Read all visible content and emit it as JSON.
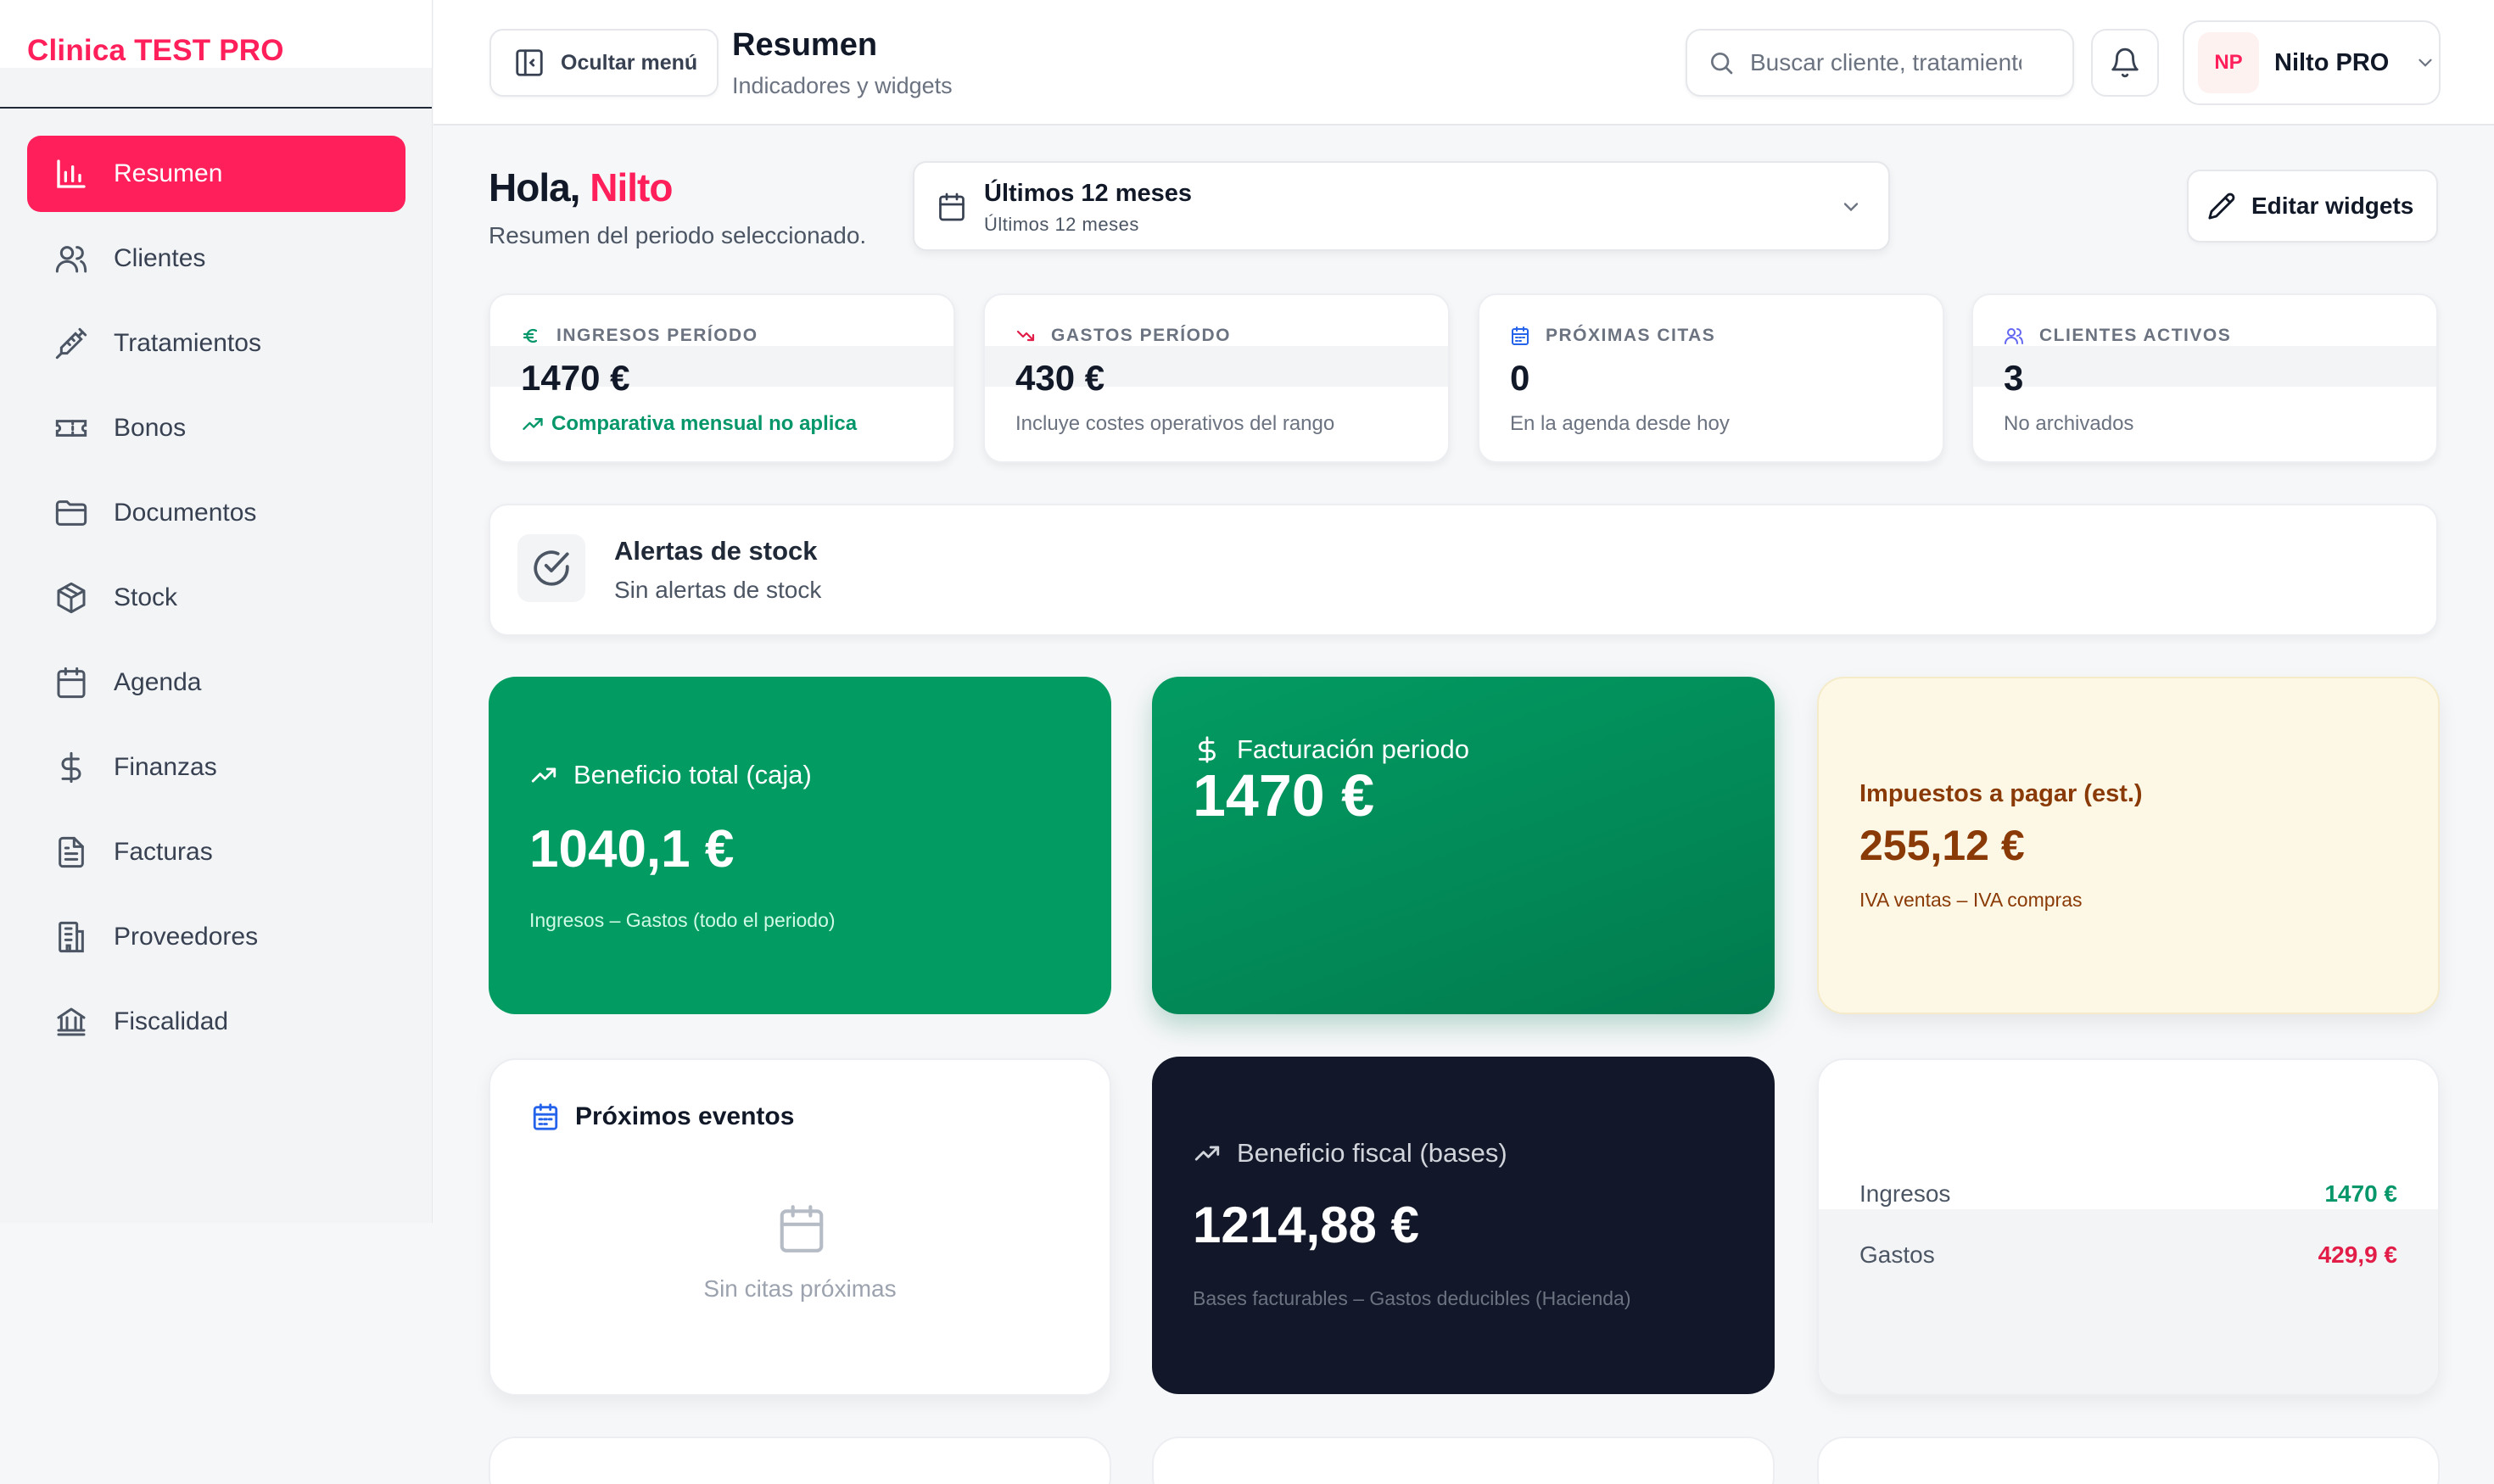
{
  "app": {
    "brand": "Clinica TEST PRO"
  },
  "sidebar": {
    "items": [
      {
        "label": "Resumen",
        "icon": "bar-chart-icon",
        "active": true
      },
      {
        "label": "Clientes",
        "icon": "users-icon"
      },
      {
        "label": "Tratamientos",
        "icon": "syringe-icon"
      },
      {
        "label": "Bonos",
        "icon": "ticket-icon"
      },
      {
        "label": "Documentos",
        "icon": "folder-icon"
      },
      {
        "label": "Stock",
        "icon": "box-icon"
      },
      {
        "label": "Agenda",
        "icon": "calendar-icon"
      },
      {
        "label": "Finanzas",
        "icon": "dollar-icon"
      },
      {
        "label": "Facturas",
        "icon": "file-icon"
      },
      {
        "label": "Proveedores",
        "icon": "building-icon"
      },
      {
        "label": "Fiscalidad",
        "icon": "bank-icon"
      }
    ]
  },
  "header": {
    "hide_menu": "Ocultar menú",
    "title": "Resumen",
    "subtitle": "Indicadores y widgets",
    "search_placeholder": "Buscar cliente, tratamiento",
    "user_initials": "NP",
    "user_name": "Nilto PRO"
  },
  "greeting": {
    "hello": "Hola,",
    "name": "Nilto",
    "subtitle": "Resumen del periodo seleccionado."
  },
  "period": {
    "selected": "Últimos 12 meses",
    "detail": "Últimos 12 meses"
  },
  "edit_widgets": "Editar widgets",
  "stats": [
    {
      "label": "INGRESOS PERÍODO",
      "value": "1470 €",
      "note": "Comparativa mensual no aplica",
      "icon": "euro-icon",
      "accent": "#059669"
    },
    {
      "label": "GASTOS PERÍODO",
      "value": "430 €",
      "note": "Incluye costes operativos del rango",
      "icon": "trending-down-icon",
      "accent": "#e11d48"
    },
    {
      "label": "PRÓXIMAS CITAS",
      "value": "0",
      "note": "En la agenda desde hoy",
      "icon": "calendar-icon",
      "accent": "#2563eb"
    },
    {
      "label": "CLIENTES ACTIVOS",
      "value": "3",
      "note": "No archivados",
      "icon": "users-icon",
      "accent": "#6366f1"
    }
  ],
  "stock_alert": {
    "title": "Alertas de stock",
    "subtitle": "Sin alertas de stock"
  },
  "widgets": {
    "profit_total": {
      "title": "Beneficio total (caja)",
      "value": "1040,1 €",
      "caption": "Ingresos – Gastos (todo el periodo)"
    },
    "billing": {
      "title": "Facturación periodo",
      "value": "1470 €"
    },
    "taxes": {
      "title": "Impuestos a pagar (est.)",
      "value": "255,12 €",
      "caption": "IVA ventas – IVA compras"
    },
    "events": {
      "title": "Próximos eventos",
      "empty": "Sin citas próximas"
    },
    "profit_fiscal": {
      "title": "Beneficio fiscal (bases)",
      "value": "1214,88 €",
      "caption": "Bases facturables – Gastos deducibles (Hacienda)"
    },
    "summary": {
      "income_label": "Ingresos",
      "income_value": "1470 €",
      "expense_label": "Gastos",
      "expense_value": "429,9 €"
    }
  },
  "colors": {
    "brand": "#ff1f5a",
    "green": "#029b62",
    "dark": "#121829",
    "tax_bg": "#fdf8e6"
  }
}
